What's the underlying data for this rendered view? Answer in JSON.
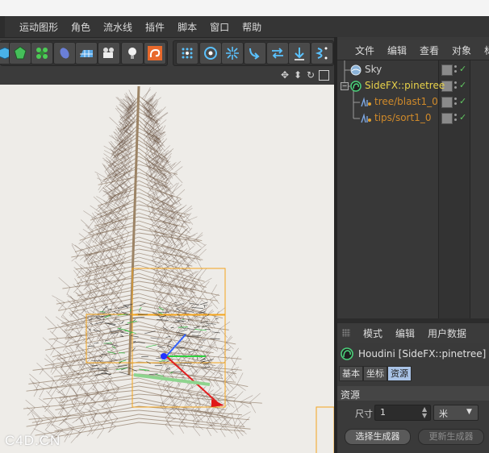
{
  "menubar": {
    "items": [
      "运动图形",
      "角色",
      "流水线",
      "插件",
      "脚本",
      "窗口",
      "帮助"
    ]
  },
  "toolbar": {
    "tools": [
      "cube-icon",
      "gem-icon",
      "cloner-icon",
      "deformer-icon",
      "floor-icon",
      "camera-icon",
      "light-icon",
      "houdini-engine-icon",
      "mograph-grid-icon",
      "target-icon",
      "explode-icon",
      "bend-icon",
      "flip-icon",
      "down-arrow-icon",
      "twist-icon"
    ]
  },
  "object_manager": {
    "menu": [
      "文件",
      "编辑",
      "查看",
      "对象",
      "标签"
    ],
    "objects": [
      {
        "name": "Sky",
        "color": "#d0d0d0"
      },
      {
        "name": "SideFX::pinetree",
        "color": "#e8d24a"
      },
      {
        "name": "tree/blast1_0",
        "color": "#d08a2a"
      },
      {
        "name": "tips/sort1_0",
        "color": "#d08a2a"
      }
    ]
  },
  "attribute_manager": {
    "menu": [
      "模式",
      "编辑",
      "用户数据"
    ],
    "object_title": "Houdini [SideFX::pinetree]",
    "tabs": [
      "基本",
      "坐标",
      "资源"
    ],
    "active_tab": "资源",
    "section": "资源",
    "size_label": "尺寸",
    "size_value": "1",
    "unit": "米",
    "select_generator": "选择生成器",
    "update_generator": "更新生成器"
  },
  "watermark": "C4D.CN"
}
